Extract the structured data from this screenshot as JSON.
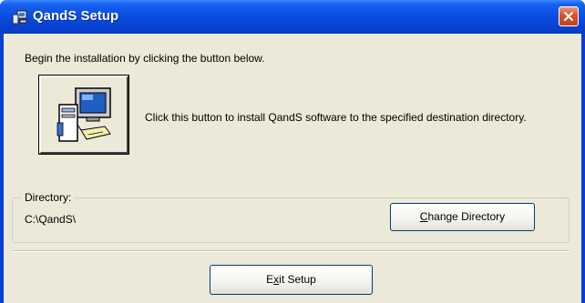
{
  "window": {
    "title": "QandS Setup",
    "accent": "#0a4fe0",
    "close_color": "#d8542d"
  },
  "main": {
    "intro_text": "Begin the installation by clicking the button below.",
    "install_description": "Click this button to install QandS software to the specified destination directory.",
    "install_icon": "computer-setup-icon"
  },
  "directory": {
    "group_label": "Directory:",
    "value": "C:\\QandS\\",
    "change_button": {
      "pre": "",
      "accel": "C",
      "post": "hange Directory"
    }
  },
  "footer": {
    "exit_button": {
      "pre": "E",
      "accel": "x",
      "post": "it Setup"
    }
  }
}
